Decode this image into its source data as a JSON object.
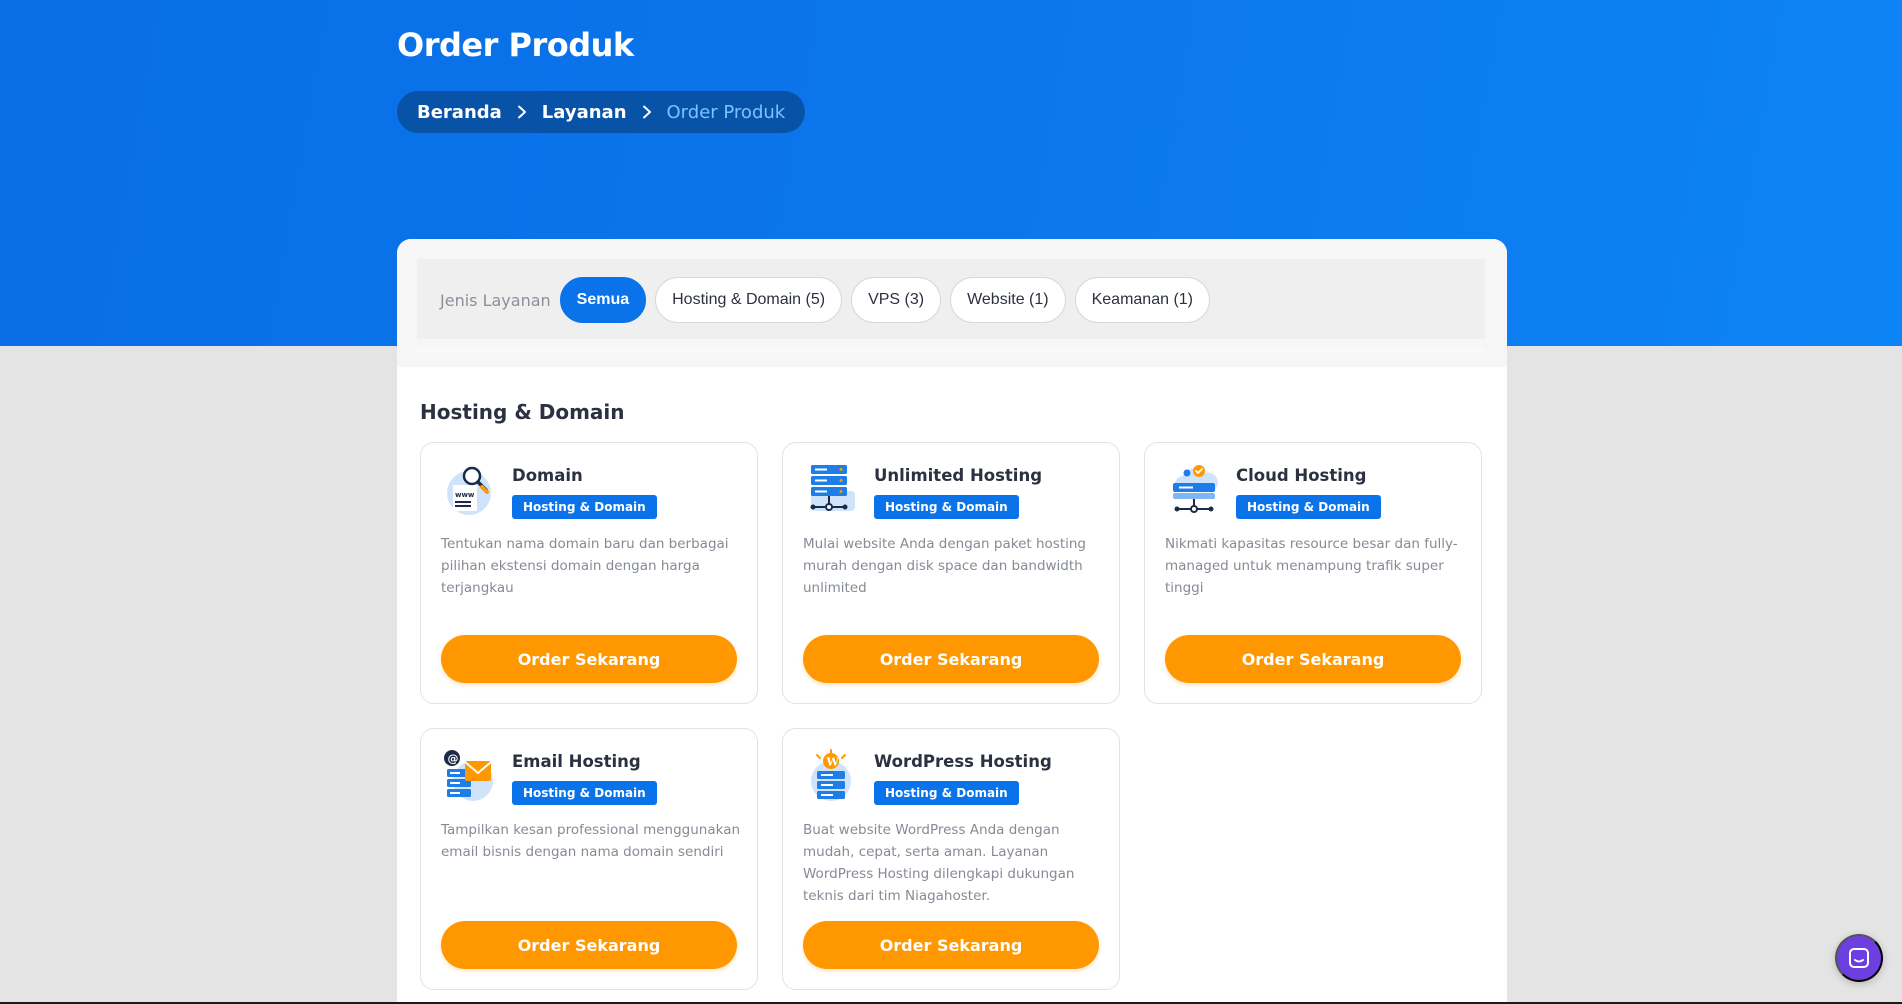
{
  "header": {
    "title": "Order Produk",
    "breadcrumb": [
      "Beranda",
      "Layanan",
      "Order Produk"
    ]
  },
  "filter": {
    "label": "Jenis Layanan",
    "chips": [
      "Semua",
      "Hosting & Domain (5)",
      "VPS (3)",
      "Website (1)",
      "Keamanan (1)"
    ],
    "active": "Semua"
  },
  "section": {
    "title": "Hosting & Domain"
  },
  "products": [
    {
      "title": "Domain",
      "badge": "Hosting & Domain",
      "description": "Tentukan nama domain baru dan berbagai pilihan ekstensi domain dengan harga terjangkau",
      "button": "Order Sekarang",
      "icon": "domain-search-icon"
    },
    {
      "title": "Unlimited Hosting",
      "badge": "Hosting & Domain",
      "description": "Mulai website Anda dengan paket hosting murah dengan disk space dan bandwidth unlimited",
      "button": "Order Sekarang",
      "icon": "server-rack-icon"
    },
    {
      "title": "Cloud Hosting",
      "badge": "Hosting & Domain",
      "description": "Nikmati kapasitas resource besar dan fully-managed untuk menampung trafik super tinggi",
      "button": "Order Sekarang",
      "icon": "cloud-server-icon"
    },
    {
      "title": "Email Hosting",
      "badge": "Hosting & Domain",
      "description": "Tampilkan kesan professional menggunakan email bisnis dengan nama domain sendiri",
      "button": "Order Sekarang",
      "icon": "email-server-icon"
    },
    {
      "title": "WordPress Hosting",
      "badge": "Hosting & Domain",
      "description": "Buat website WordPress Anda dengan mudah, cepat, serta aman. Layanan WordPress Hosting dilengkapi dukungan teknis dari tim Niagahoster.",
      "button": "Order Sekarang",
      "icon": "wordpress-server-icon"
    }
  ],
  "chat": {
    "icon": "chat-icon"
  },
  "colors": {
    "primary": "#0a73ea",
    "accent": "#ff9800",
    "chat": "#6d3ee0"
  }
}
